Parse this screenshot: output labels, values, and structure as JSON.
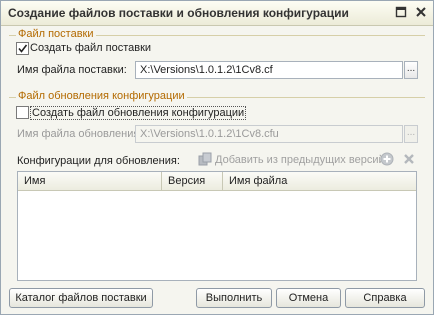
{
  "window": {
    "title": "Создание файлов поставки и обновления конфигурации"
  },
  "delivery": {
    "group_title": "Файл поставки",
    "create_label": "Создать файл поставки",
    "create_checked": true,
    "file_label": "Имя файла поставки:",
    "file_value": "X:\\Versions\\1.0.1.2\\1Cv8.cf",
    "browse_label": "..."
  },
  "update": {
    "group_title": "Файл обновления конфигурации",
    "create_label": "Создать файл обновления конфигурации",
    "create_checked": false,
    "file_label": "Имя файла обновления:",
    "file_value": "X:\\Versions\\1.0.1.2\\1Cv8.cfu",
    "browse_label": "...",
    "configs_label": "Конфигурации для обновления:",
    "add_prev_label": "Добавить из предыдущих версий"
  },
  "table": {
    "columns": [
      "Имя",
      "Версия",
      "Имя файла"
    ],
    "rows": []
  },
  "buttons": {
    "catalog": "Каталог файлов поставки",
    "run": "Выполнить",
    "cancel": "Отмена",
    "help": "Справка"
  },
  "colors": {
    "group_title": "#b36a00",
    "accent_border": "#8f9aa6"
  }
}
